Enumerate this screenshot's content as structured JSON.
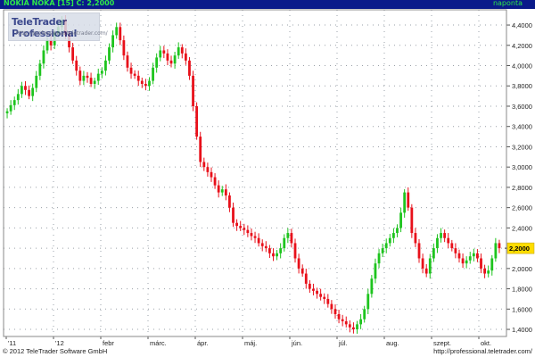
{
  "header": {
    "title": "NOKIA NOKA [15] C: 2,2000",
    "period": "naponta"
  },
  "logo": {
    "brand": "TeleTrader Professional",
    "url": "http://professional.teletrader.com/"
  },
  "footer": {
    "copyright": "© 2012 TeleTrader Software GmbH",
    "site": "http://professional.teletrader.com/"
  },
  "colors": {
    "up": "#1ec41e",
    "down": "#e8101a",
    "header_bg": "#0a1a8a",
    "price_box": "#ffdd00"
  },
  "chart_data": {
    "type": "candlestick",
    "x_tick_labels": [
      "'11",
      "'12",
      "febr",
      "márc.",
      "ápr.",
      "máj.",
      "jún.",
      "júl.",
      "aug.",
      "szept.",
      "okt."
    ],
    "y_tick_labels": [
      "4,4000",
      "4,2000",
      "4,0000",
      "3,8000",
      "3,6000",
      "3,4000",
      "3,2000",
      "3,0000",
      "2,8000",
      "2,6000",
      "2,4000",
      "2,2000",
      "2,0000",
      "1,8000",
      "1,6000",
      "1,4000"
    ],
    "ylim": [
      1.33,
      4.55
    ],
    "last_price": 2.2,
    "last_price_label": "2,2000",
    "grid": true,
    "closes": [
      3.55,
      3.61,
      3.66,
      3.72,
      3.8,
      3.76,
      3.7,
      3.78,
      3.9,
      4.02,
      4.15,
      4.25,
      4.2,
      4.32,
      4.38,
      4.45,
      4.3,
      4.18,
      4.05,
      3.95,
      3.85,
      3.9,
      3.88,
      3.82,
      3.85,
      3.92,
      3.95,
      4.05,
      4.18,
      4.3,
      4.38,
      4.25,
      4.1,
      3.98,
      3.92,
      3.9,
      3.85,
      3.82,
      3.8,
      3.85,
      3.98,
      4.08,
      4.15,
      4.12,
      4.05,
      4.02,
      4.1,
      4.18,
      4.12,
      4.05,
      3.9,
      3.6,
      3.3,
      3.05,
      3.0,
      2.95,
      2.9,
      2.82,
      2.75,
      2.78,
      2.72,
      2.6,
      2.45,
      2.42,
      2.4,
      2.38,
      2.35,
      2.32,
      2.3,
      2.25,
      2.22,
      2.2,
      2.15,
      2.12,
      2.15,
      2.2,
      2.3,
      2.35,
      2.25,
      2.1,
      2.0,
      1.95,
      1.85,
      1.8,
      1.78,
      1.75,
      1.72,
      1.7,
      1.65,
      1.6,
      1.55,
      1.5,
      1.48,
      1.45,
      1.42,
      1.4,
      1.45,
      1.5,
      1.6,
      1.75,
      1.9,
      2.05,
      2.15,
      2.2,
      2.25,
      2.3,
      2.35,
      2.4,
      2.55,
      2.75,
      2.6,
      2.35,
      2.25,
      2.1,
      2.0,
      1.95,
      2.1,
      2.2,
      2.3,
      2.35,
      2.3,
      2.25,
      2.2,
      2.15,
      2.1,
      2.05,
      2.08,
      2.12,
      2.15,
      2.1,
      2.0,
      1.95,
      1.98,
      2.1,
      2.25,
      2.2
    ]
  }
}
